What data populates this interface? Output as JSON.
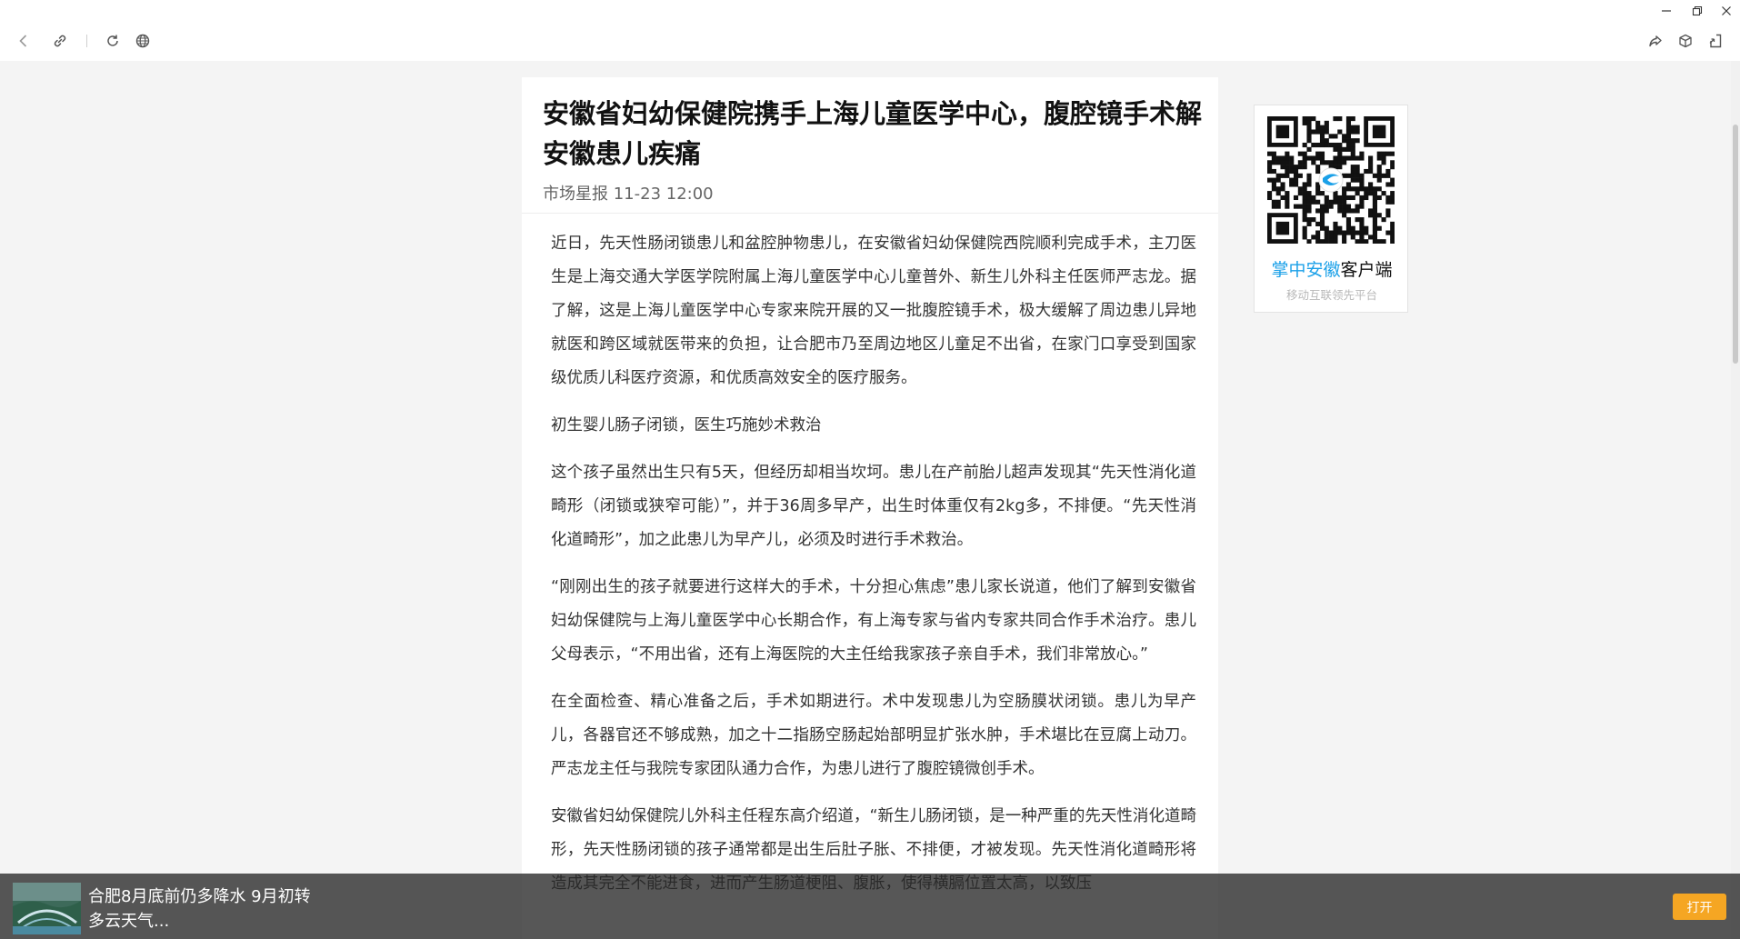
{
  "toolbar": {
    "icons": [
      "back-icon",
      "link-icon",
      "refresh-icon",
      "globe-icon",
      "share-icon",
      "cube-icon",
      "reader-icon"
    ],
    "window_controls": [
      "minimize-icon",
      "restore-icon",
      "close-icon"
    ]
  },
  "article": {
    "title": "安徽省妇幼保健院携手上海儿童医学中心，腹腔镜手术解安徽患儿疾痛",
    "meta": "市场星报 11-23 12:00",
    "paragraphs": [
      "近日，先天性肠闭锁患儿和盆腔肿物患儿，在安徽省妇幼保健院西院顺利完成手术，主刀医生是上海交通大学医学院附属上海儿童医学中心儿童普外、新生儿外科主任医师严志龙。据了解，这是上海儿童医学中心专家来院开展的又一批腹腔镜手术，极大缓解了周边患儿异地就医和跨区域就医带来的负担，让合肥市乃至周边地区儿童足不出省，在家门口享受到国家级优质儿科医疗资源，和优质高效安全的医疗服务。",
      "初生婴儿肠子闭锁，医生巧施妙术救治",
      "这个孩子虽然出生只有5天，但经历却相当坎坷。患儿在产前胎儿超声发现其“先天性消化道畸形（闭锁或狭窄可能）”，并于36周多早产，出生时体重仅有2kg多，不排便。“先天性消化道畸形”，加之此患儿为早产儿，必须及时进行手术救治。",
      "“刚刚出生的孩子就要进行这样大的手术，十分担心焦虑”患儿家长说道，他们了解到安徽省妇幼保健院与上海儿童医学中心长期合作，有上海专家与省内专家共同合作手术治疗。患儿父母表示，“不用出省，还有上海医院的大主任给我家孩子亲自手术，我们非常放心。”",
      "在全面检查、精心准备之后，手术如期进行。术中发现患儿为空肠膜状闭锁。患儿为早产儿，各器官还不够成熟，加之十二指肠空肠起始部明显扩张水肿，手术堪比在豆腐上动刀。严志龙主任与我院专家团队通力合作，为患儿进行了腹腔镜微创手术。",
      "安徽省妇幼保健院儿外科主任程东高介绍道，“新生儿肠闭锁，是一种严重的先天性消化道畸形，先天性肠闭锁的孩子通常都是出生后肚子胀、不排便，才被发现。先天性消化道畸形将造成其完全不能进食，进而产生肠道梗阻、腹胀，使得横膈位置太高，以致压"
    ]
  },
  "sidebar": {
    "qr_brand": "掌中安徽",
    "qr_title_rest": "客户端",
    "qr_subtitle": "移动互联领先平台"
  },
  "banner": {
    "text": "合肥8月底前仍多降水 9月初转多云天气...",
    "open_label": "打开"
  },
  "colors": {
    "brand_blue": "#1aa0e8",
    "open_button": "#f5a623"
  }
}
